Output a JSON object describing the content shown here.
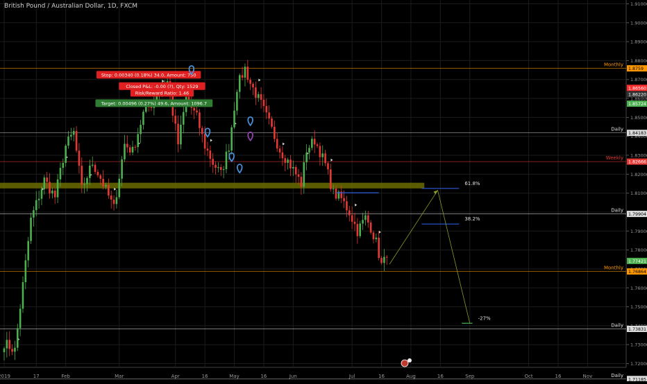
{
  "header": {
    "title": "British Pound / Australian Dollar, 1D, FXCM"
  },
  "colors": {
    "background": "#000000",
    "up": "#26a69a",
    "upBody": "#4caf50",
    "down": "#e53935",
    "grid": "#1c1c1c",
    "axisText": "#9a9a9a",
    "zone": "#6b6b00",
    "fib": "#2d5bd8",
    "orange": "#ff9800"
  },
  "chart_data": {
    "type": "candlestick",
    "y_axis": {
      "ylim": [
        1.718,
        1.912
      ],
      "ticks": [
        1.91,
        1.9,
        1.89,
        1.88,
        1.87,
        1.86,
        1.85,
        1.84,
        1.83,
        1.82,
        1.81,
        1.8,
        1.79,
        1.78,
        1.77,
        1.76,
        1.75,
        1.74,
        1.73,
        1.72
      ]
    },
    "x_axis": {
      "ticks": [
        {
          "label": "2019",
          "i": 0
        },
        {
          "label": "17",
          "i": 12
        },
        {
          "label": "Feb",
          "i": 23
        },
        {
          "label": "Mar",
          "i": 43
        },
        {
          "label": "Apr",
          "i": 64
        },
        {
          "label": "16",
          "i": 75
        },
        {
          "label": "May",
          "i": 86
        },
        {
          "label": "16",
          "i": 97
        },
        {
          "label": "Jun",
          "i": 108
        },
        {
          "label": "Jul",
          "i": 130
        },
        {
          "label": "16",
          "i": 141
        },
        {
          "label": "Aug",
          "i": 152
        },
        {
          "label": "16",
          "i": 163
        },
        {
          "label": "Sep",
          "i": 174
        },
        {
          "label": "Oct",
          "i": 196
        },
        {
          "label": "16",
          "i": 207
        },
        {
          "label": "Nov",
          "i": 218
        }
      ]
    },
    "close_anchors": [
      [
        0,
        1.731
      ],
      [
        4,
        1.727
      ],
      [
        10,
        1.796
      ],
      [
        15,
        1.817
      ],
      [
        19,
        1.808
      ],
      [
        23,
        1.835
      ],
      [
        26,
        1.842
      ],
      [
        29,
        1.812
      ],
      [
        33,
        1.826
      ],
      [
        36,
        1.818
      ],
      [
        41,
        1.802
      ],
      [
        45,
        1.836
      ],
      [
        48,
        1.832
      ],
      [
        52,
        1.852
      ],
      [
        55,
        1.857
      ],
      [
        58,
        1.865
      ],
      [
        61,
        1.869
      ],
      [
        65,
        1.836
      ],
      [
        68,
        1.86
      ],
      [
        72,
        1.85
      ],
      [
        75,
        1.835
      ],
      [
        78,
        1.826
      ],
      [
        81,
        1.82
      ],
      [
        84,
        1.835
      ],
      [
        87,
        1.866
      ],
      [
        90,
        1.876
      ],
      [
        92,
        1.868
      ],
      [
        96,
        1.857
      ],
      [
        99,
        1.847
      ],
      [
        103,
        1.833
      ],
      [
        106,
        1.827
      ],
      [
        109,
        1.82
      ],
      [
        111,
        1.815
      ],
      [
        113,
        1.833
      ],
      [
        116,
        1.838
      ],
      [
        118,
        1.832
      ],
      [
        120,
        1.825
      ],
      [
        123,
        1.81
      ],
      [
        126,
        1.807
      ],
      [
        129,
        1.8
      ],
      [
        132,
        1.79
      ],
      [
        135,
        1.797
      ],
      [
        137,
        1.792
      ],
      [
        139,
        1.784
      ],
      [
        141,
        1.772
      ],
      [
        143,
        1.776
      ]
    ],
    "horizontal_levels": [
      {
        "price": 1.8759,
        "label": "Monthly",
        "badge": "1.8759",
        "color": "#ff9800",
        "style": "thin"
      },
      {
        "price": 1.8656,
        "label": "",
        "badge": "1.86560",
        "color": "#ff2e2e",
        "style": "none"
      },
      {
        "price": 1.8622,
        "label": "",
        "badge": "1.86220",
        "color": "#333333",
        "style": "none"
      },
      {
        "price": 1.85724,
        "label": "",
        "badge": "1.85724",
        "color": "#4caf50",
        "style": "none"
      },
      {
        "price": 1.84183,
        "label": "Daily",
        "badge": "1.84183",
        "color": "#dddddd",
        "style": "thin"
      },
      {
        "price": 1.82666,
        "label": "Weekly",
        "badge": "1.82666",
        "color": "#e53935",
        "style": "thin"
      },
      {
        "price": 1.79904,
        "label": "Daily",
        "badge": "1.79904",
        "color": "#dddddd",
        "style": "thin"
      },
      {
        "price": 1.77421,
        "label": "",
        "badge": "1.77421",
        "color": "#4caf50",
        "style": "none"
      },
      {
        "price": 1.76864,
        "label": "Monthly",
        "badge": "1.76864",
        "color": "#ff9800",
        "style": "thin"
      },
      {
        "price": 1.73831,
        "label": "Daily",
        "badge": "1.73831",
        "color": "#dddddd",
        "style": "thin"
      },
      {
        "price": 1.71185,
        "label": "Daily",
        "badge": "1.71185",
        "color": "#dddddd",
        "style": "thin"
      }
    ],
    "zone": {
      "from": 1.8125,
      "to": 1.8155,
      "i_end": 157
    },
    "fib_levels": [
      {
        "label": "61.8%",
        "price": 1.8125,
        "i_from": 156,
        "i_to": 170
      },
      {
        "label": "38.2%",
        "price": 1.7937,
        "i_from": 156,
        "i_to": 170
      },
      {
        "label": "-27%",
        "price": 1.7413,
        "i_from": 171,
        "i_to": 175
      }
    ],
    "fib_blue_line": {
      "price": 1.8102,
      "i_from": 124,
      "i_to": 140
    },
    "projection": [
      [
        144,
        1.7725
      ],
      [
        162,
        1.8115
      ],
      [
        174,
        1.7413
      ]
    ],
    "trade_boxes": [
      {
        "text": "Stop: 0.00340 (0.18%) 34.0, Amount: 750",
        "color": "#e02020",
        "price": 1.8725,
        "i": 54
      },
      {
        "text": "Closed P&L: -0.00 (?), Qty: 1529",
        "color": "#e02020",
        "price": 1.8665,
        "i": 59
      },
      {
        "text": "Risk/Reward Ratio: 1.46",
        "color": "#e02020",
        "price": 1.863,
        "i": 59
      },
      {
        "text": "Target: 0.00496 (0.27%) 49.6, Amount: 1096.7",
        "color": "#2e7d32",
        "price": 1.8575,
        "i": 56
      }
    ],
    "watermark_label": ""
  }
}
